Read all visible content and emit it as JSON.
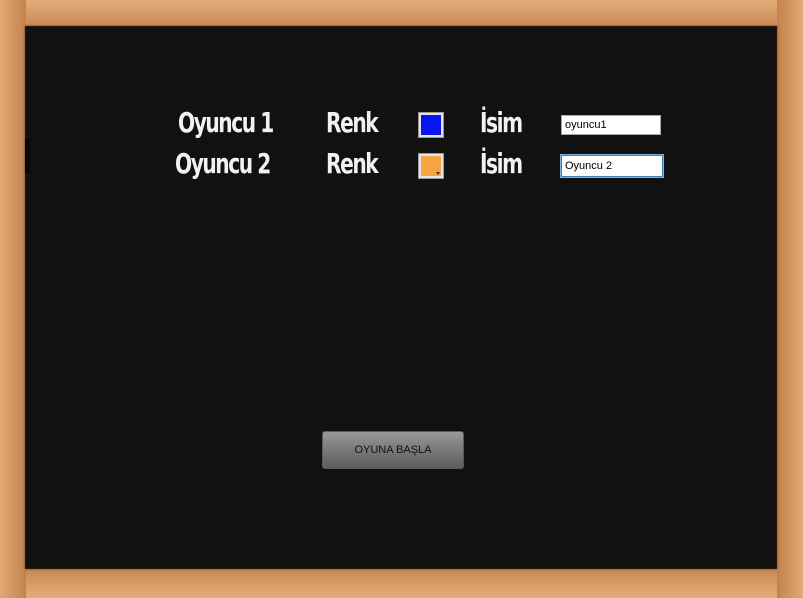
{
  "players": [
    {
      "player_label": "Oyuncu 1",
      "color_label": "Renk",
      "color_value": "#0a14f0",
      "name_label": "İsim",
      "name_value": "oyuncu1"
    },
    {
      "player_label": "Oyuncu 2",
      "color_label": "Renk",
      "color_value": "#f7a540",
      "name_label": "İsim",
      "name_value": "Oyuncu 2"
    }
  ],
  "start_button": {
    "label": "OYUNA BAŞLA"
  }
}
